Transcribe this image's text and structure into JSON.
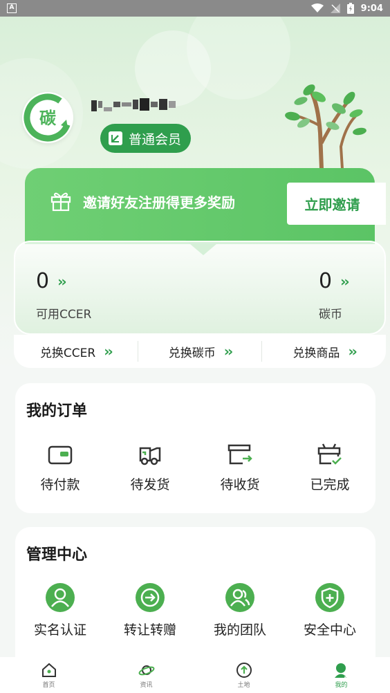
{
  "status_bar": {
    "time": "9:04"
  },
  "profile": {
    "avatar_logo_text": "碳",
    "member_level": "普通会员"
  },
  "invite": {
    "text": "邀请好友注册得更多奖励",
    "button": "立即邀请"
  },
  "balance": {
    "ccer_value": "0",
    "ccer_label": "可用CCER",
    "coin_value": "0",
    "coin_label": "碳币"
  },
  "exchange": [
    {
      "label": "兑换CCER"
    },
    {
      "label": "兑换碳币"
    },
    {
      "label": "兑换商品"
    }
  ],
  "orders": {
    "title": "我的订单",
    "items": [
      {
        "label": "待付款",
        "icon": "wallet-icon"
      },
      {
        "label": "待发货",
        "icon": "truck-icon"
      },
      {
        "label": "待收货",
        "icon": "box-arrow-icon"
      },
      {
        "label": "已完成",
        "icon": "gift-check-icon"
      }
    ]
  },
  "management": {
    "title": "管理中心",
    "items": [
      {
        "label": "实名认证",
        "icon": "user-verify-icon"
      },
      {
        "label": "转让转赠",
        "icon": "transfer-icon"
      },
      {
        "label": "我的团队",
        "icon": "team-icon"
      },
      {
        "label": "安全中心",
        "icon": "shield-icon"
      }
    ]
  },
  "bottom_nav": [
    {
      "label": "首页",
      "icon": "home-icon"
    },
    {
      "label": "资讯",
      "icon": "planet-icon"
    },
    {
      "label": "土地",
      "icon": "upload-circle-icon"
    },
    {
      "label": "我的",
      "icon": "profile-icon"
    }
  ],
  "colors": {
    "brand": "#2f9e4d",
    "banner": "#5bc465"
  }
}
